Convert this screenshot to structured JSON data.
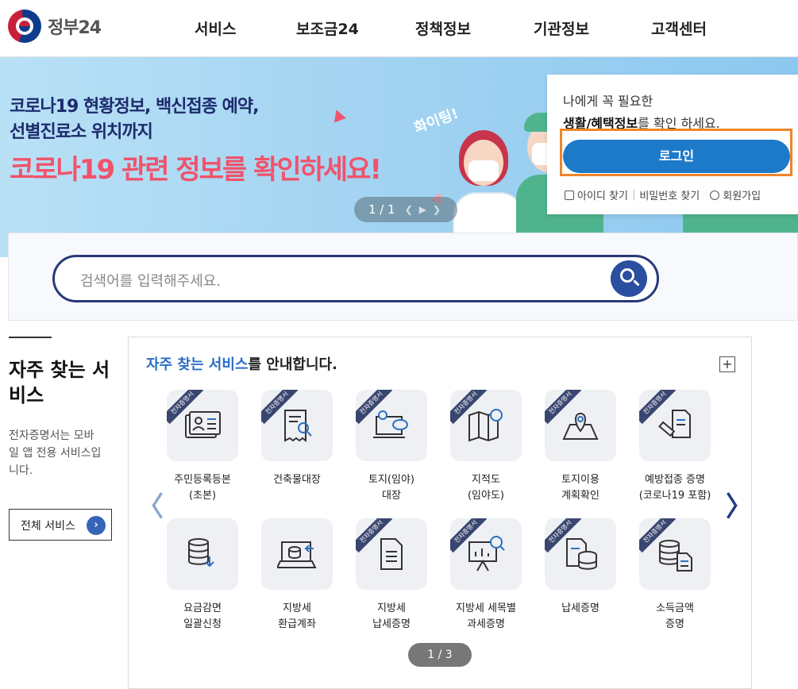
{
  "header": {
    "logo_text": "정부24",
    "nav": [
      "서비스",
      "보조금24",
      "정책정보",
      "기관정보",
      "고객센터"
    ]
  },
  "banner": {
    "line1": "코로나19 현황정보, 백신접종 예약,",
    "line2": "선별진료소 위치까지",
    "headline": "코로나19 관련 정보를 확인하세요!",
    "fighting": "화이팅!",
    "pager": "1 / 1"
  },
  "login": {
    "message_line1": "나에게 꼭 필요한",
    "message_bold": "생활/혜택정보",
    "message_tail": "를 확인 하세요.",
    "button": "로그인",
    "find_id": "아이디 찾기",
    "find_pw": "비밀번호 찾기",
    "join": "회원가입"
  },
  "search": {
    "placeholder": "검색어를 입력해주세요."
  },
  "side": {
    "title": "자주 찾는 서비스",
    "description": "전자증명서는 모바일 앱 전용 서비스입니다.",
    "all_button": "전체 서비스"
  },
  "services": {
    "title_highlight": "자주 찾는 서비스",
    "title_rest": "를 안내합니다.",
    "ribbon": "전자증명서",
    "page": "1 / 3",
    "items": [
      {
        "label1": "주민등록등본",
        "label2": "(초본)",
        "icon": "id-card-icon",
        "ribbon": true
      },
      {
        "label1": "건축물대장",
        "label2": "",
        "icon": "building-register-icon",
        "ribbon": true
      },
      {
        "label1": "토지(임야)",
        "label2": "대장",
        "icon": "land-laptop-icon",
        "ribbon": true
      },
      {
        "label1": "지적도",
        "label2": "(임야도)",
        "icon": "map-compass-icon",
        "ribbon": true
      },
      {
        "label1": "토지이용",
        "label2": "계획확인",
        "icon": "map-pin-icon",
        "ribbon": true
      },
      {
        "label1": "예방접종 증명",
        "label2": "(코로나19 포함)",
        "icon": "vaccine-icon",
        "ribbon": true
      },
      {
        "label1": "요금감면",
        "label2": "일괄신청",
        "icon": "database-download-icon",
        "ribbon": false
      },
      {
        "label1": "지방세",
        "label2": "환급계좌",
        "icon": "laptop-database-icon",
        "ribbon": false
      },
      {
        "label1": "지방세",
        "label2": "납세증명",
        "icon": "document-icon",
        "ribbon": true
      },
      {
        "label1": "지방세 세목별",
        "label2": "과세증명",
        "icon": "chart-board-icon",
        "ribbon": true
      },
      {
        "label1": "납세증명",
        "label2": "",
        "icon": "document-database-icon",
        "ribbon": true
      },
      {
        "label1": "소득금액",
        "label2": "증명",
        "icon": "database-document-icon",
        "ribbon": true
      }
    ]
  }
}
